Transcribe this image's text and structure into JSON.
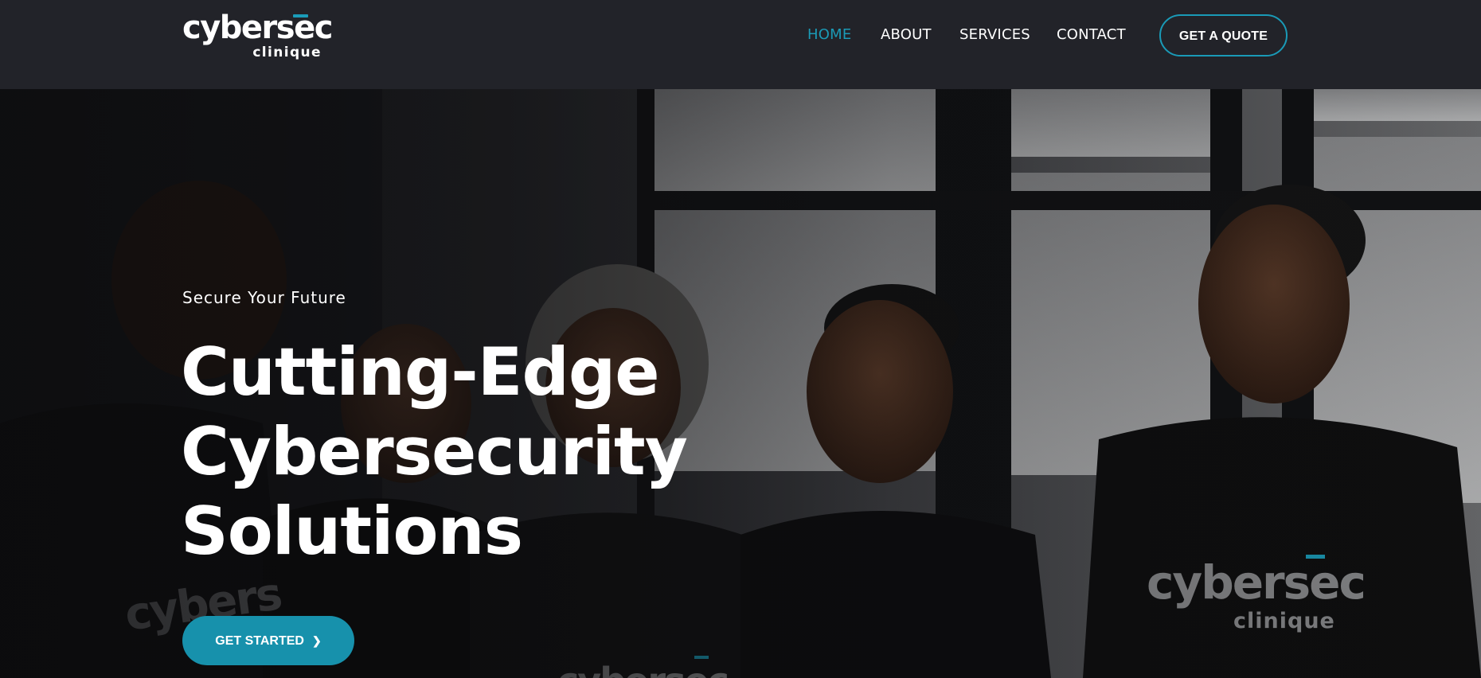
{
  "brand": {
    "name_main": "cybersec",
    "name_sub": "clinique",
    "accent_color": "#1a9cb9"
  },
  "nav": {
    "items": [
      {
        "label": "HOME",
        "active": true
      },
      {
        "label": "ABOUT",
        "active": false
      },
      {
        "label": "SERVICES",
        "active": false
      },
      {
        "label": "CONTACT",
        "active": false
      }
    ],
    "cta_label": "GET A QUOTE"
  },
  "hero": {
    "eyebrow": "Secure Your Future",
    "headline_lines": [
      "Cutting-Edge",
      "Cybersecurity",
      "Solutions"
    ],
    "cta_label": "GET STARTED",
    "cta_icon": "chevron-right-icon",
    "image_description_tag": "team-photo",
    "shirt_logo_main": "cybersec",
    "shirt_logo_sub": "clinique"
  },
  "colors": {
    "header_bg": "#222329",
    "nav_active": "#1b9ab6",
    "button_bg": "#1791ac",
    "text": "#ffffff"
  }
}
